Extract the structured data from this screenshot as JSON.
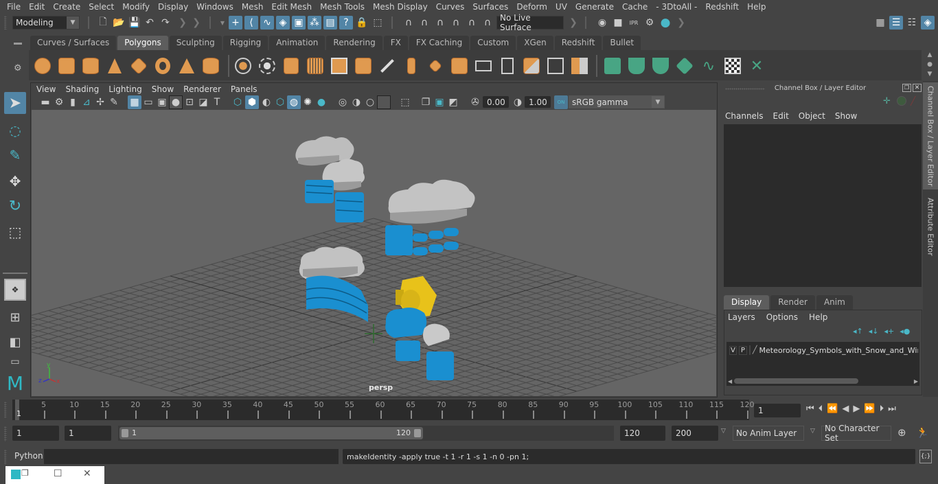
{
  "menubar": {
    "items": [
      "File",
      "Edit",
      "Create",
      "Select",
      "Modify",
      "Display",
      "Windows",
      "Mesh",
      "Edit Mesh",
      "Mesh Tools",
      "Mesh Display",
      "Curves",
      "Surfaces",
      "Deform",
      "UV",
      "Generate",
      "Cache",
      "- 3DtoAll -",
      "Redshift",
      "Help"
    ]
  },
  "statusline": {
    "workspace": "Modeling",
    "live_surface": "No Live Surface"
  },
  "shelf": {
    "tabs": [
      "Curves / Surfaces",
      "Polygons",
      "Sculpting",
      "Rigging",
      "Animation",
      "Rendering",
      "FX",
      "FX Caching",
      "Custom",
      "XGen",
      "Redshift",
      "Bullet"
    ],
    "active_tab": "Polygons"
  },
  "viewport": {
    "menu": [
      "View",
      "Shading",
      "Lighting",
      "Show",
      "Renderer",
      "Panels"
    ],
    "exposure": "0.00",
    "gamma": "1.00",
    "color_management_badge": "ON",
    "colorspace": "sRGB gamma",
    "camera_label": "persp",
    "axis": {
      "x": "x",
      "y": "y",
      "z": "z"
    },
    "colors": {
      "snow_blue": "#1a8fd0",
      "sun_yellow": "#e8c21a",
      "cloud_gray": "#c8c8c8",
      "grid_bg": "#656565"
    }
  },
  "channelbox": {
    "title": "Channel Box / Layer Editor",
    "menu": [
      "Channels",
      "Edit",
      "Object",
      "Show"
    ]
  },
  "layereditor": {
    "tabs": [
      "Display",
      "Render",
      "Anim"
    ],
    "active_tab": "Display",
    "menu": [
      "Layers",
      "Options",
      "Help"
    ],
    "layers": [
      {
        "v": "V",
        "p": "P",
        "name": "Meteorology_Symbols_with_Snow_and_Wind"
      }
    ]
  },
  "sidetabs": [
    "Channel Box / Layer Editor",
    "Attribute Editor"
  ],
  "timeline": {
    "ticks": [
      5,
      10,
      15,
      20,
      25,
      30,
      35,
      40,
      45,
      50,
      55,
      60,
      65,
      70,
      75,
      80,
      85,
      90,
      95,
      100,
      105,
      110,
      115,
      120
    ],
    "start_label": "1",
    "current_frame": "1"
  },
  "range": {
    "start": "1",
    "playback_start": "1",
    "slider_start": "1",
    "slider_end": "120",
    "playback_end": "120",
    "end": "200",
    "anim_layer": "No Anim Layer",
    "character_set": "No Character Set"
  },
  "cmdline": {
    "language": "Python",
    "input": "",
    "result": "makeIdentity -apply true -t 1 -r 1 -s 1 -n 0 -pn 1;"
  }
}
